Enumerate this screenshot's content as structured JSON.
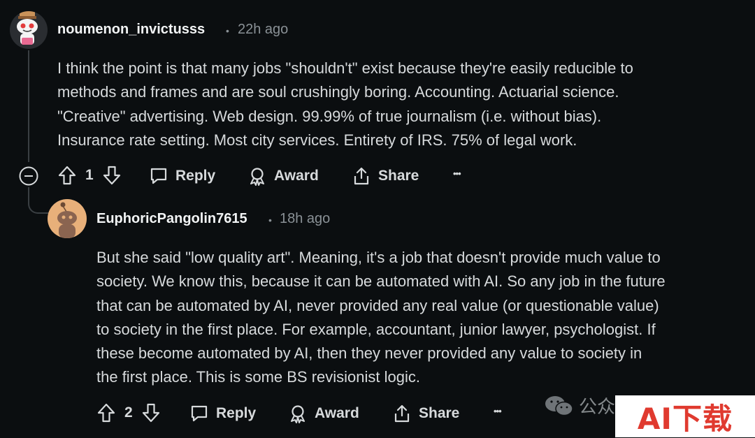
{
  "comments": [
    {
      "username": "noumenon_invictusss",
      "separator": "•",
      "time": "22h ago",
      "body": [
        "I think the point is that many jobs \"shouldn't\" exist because they're easily reducible to",
        "methods and frames and are soul crushingly boring. Accounting. Actuarial science.",
        "\"Creative\" advertising. Web design. 99.99% of true journalism (i.e. without bias).",
        "Insurance rate setting. Most city services. Entirety of IRS. 75% of legal work."
      ],
      "votes": "1",
      "reply_label": "Reply",
      "award_label": "Award",
      "share_label": "Share",
      "more_label": "•••"
    },
    {
      "username": "EuphoricPangolin7615",
      "separator": "•",
      "time": "18h ago",
      "body": [
        "But she said \"low quality art\". Meaning, it's a job that doesn't provide much value to",
        "society. We know this, because it can be automated with AI. So any job in the future",
        "that can be automated by AI, never provided any real value (or questionable value)",
        "to society in the first place. For example, accountant, junior lawyer, psychologist. If",
        "these become automated by AI, then they never provided any value to society in",
        "the first place. This is some BS revisionist logic."
      ],
      "votes": "2",
      "reply_label": "Reply",
      "award_label": "Award",
      "share_label": "Share",
      "more_label": "•••"
    }
  ],
  "watermark": {
    "wechat_text": "公众",
    "logo_text": "AI下载"
  },
  "colors": {
    "background": "#0b0e10",
    "text": "#d7dadc",
    "muted": "#8a9196",
    "thread_line": "#3a3f43",
    "avatar2_bg": "#e8b07a",
    "logo_red": "#e03a2f",
    "logo_green": "#2e9b3e"
  }
}
